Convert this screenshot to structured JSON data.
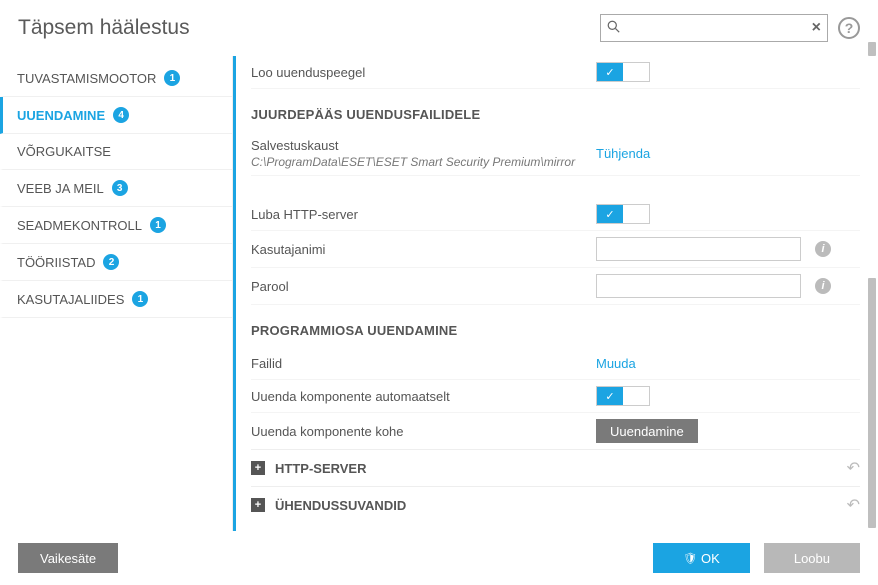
{
  "header": {
    "title": "Täpsem häälestus",
    "search_placeholder": ""
  },
  "sidebar": {
    "items": [
      {
        "label": "TUVASTAMISMOOTOR",
        "badge": "1"
      },
      {
        "label": "UUENDAMINE",
        "badge": "4"
      },
      {
        "label": "VÕRGUKAITSE",
        "badge": ""
      },
      {
        "label": "VEEB JA MEIL",
        "badge": "3"
      },
      {
        "label": "SEADMEKONTROLL",
        "badge": "1"
      },
      {
        "label": "TÖÖRIISTAD",
        "badge": "2"
      },
      {
        "label": "KASUTAJALIIDES",
        "badge": "1"
      }
    ]
  },
  "main": {
    "create_mirror_label": "Loo uuenduspeegel",
    "section_access": "JUURDEPÄÄS UUENDUSFAILIDELE",
    "storage_label": "Salvestuskaust",
    "storage_path": "C:\\ProgramData\\ESET\\ESET Smart Security Premium\\mirror",
    "clear_link": "Tühjenda",
    "http_label": "Luba HTTP-server",
    "username_label": "Kasutajanimi",
    "password_label": "Parool",
    "section_program": "PROGRAMMIOSA UUENDAMINE",
    "files_label": "Failid",
    "edit_link": "Muuda",
    "auto_update_label": "Uuenda komponente automaatselt",
    "update_now_label": "Uuenda komponente kohe",
    "update_btn": "Uuendamine",
    "expand_http": "HTTP-SERVER",
    "expand_conn": "ÜHENDUSSUVANDID"
  },
  "footer": {
    "default_btn": "Vaikesäte",
    "ok_btn": "OK",
    "cancel_btn": "Loobu"
  }
}
